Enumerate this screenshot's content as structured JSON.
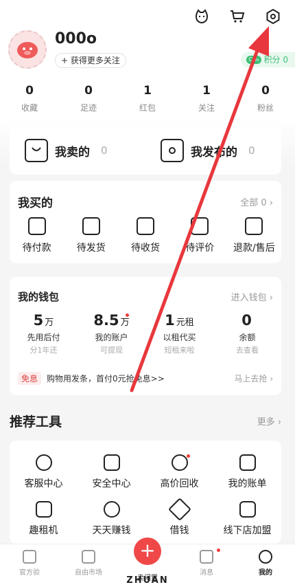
{
  "profile": {
    "username": "000o",
    "follow_pill": "+ 获得更多关注",
    "points_prefix": "CO₂",
    "points_label": "积分 0"
  },
  "stats": [
    {
      "value": "0",
      "label": "收藏"
    },
    {
      "value": "0",
      "label": "足迹"
    },
    {
      "value": "1",
      "label": "红包"
    },
    {
      "value": "1",
      "label": "关注"
    },
    {
      "value": "0",
      "label": "粉丝"
    }
  ],
  "sell": {
    "items": [
      {
        "title": "我卖的",
        "count": "0"
      },
      {
        "title": "我发布的",
        "count": "0"
      }
    ]
  },
  "buy": {
    "title": "我买的",
    "all_link": "全部 0 ›",
    "items": [
      "待付款",
      "待发货",
      "待收货",
      "待评价",
      "退款/售后"
    ]
  },
  "wallet": {
    "title": "我的钱包",
    "link": "进入钱包 ›",
    "items": [
      {
        "value": "5",
        "unit": "万",
        "label": "先用后付",
        "sub": "分1年还"
      },
      {
        "value": "8.5",
        "unit": "万",
        "label": "我的账户",
        "sub": "可提现"
      },
      {
        "value": "1",
        "unit": "元租",
        "label": "以租代买",
        "sub": "短租来啦"
      },
      {
        "value": "0",
        "unit": "",
        "label": "余额",
        "sub": "去查看"
      }
    ],
    "promo_tag": "免息",
    "promo_text": "购物用发条，首付0元抢免息>>",
    "promo_link": "马上去抢 ›"
  },
  "tools": {
    "title": "推荐工具",
    "more": "更多 ›",
    "row1": [
      "客服中心",
      "安全中心",
      "高价回收",
      "我的账单"
    ],
    "row2": [
      "趣租机",
      "天天赚钱",
      "借钱",
      "线下店加盟"
    ]
  },
  "tabbar": {
    "items": [
      "官方验",
      "自由市场",
      "卖闲置",
      "消息",
      "我的"
    ],
    "brand": "ZHUAN",
    "fab": "+"
  },
  "colors": {
    "accent": "#f04848",
    "green": "#3cbf76",
    "annotation_arrow": "#e8383d"
  }
}
